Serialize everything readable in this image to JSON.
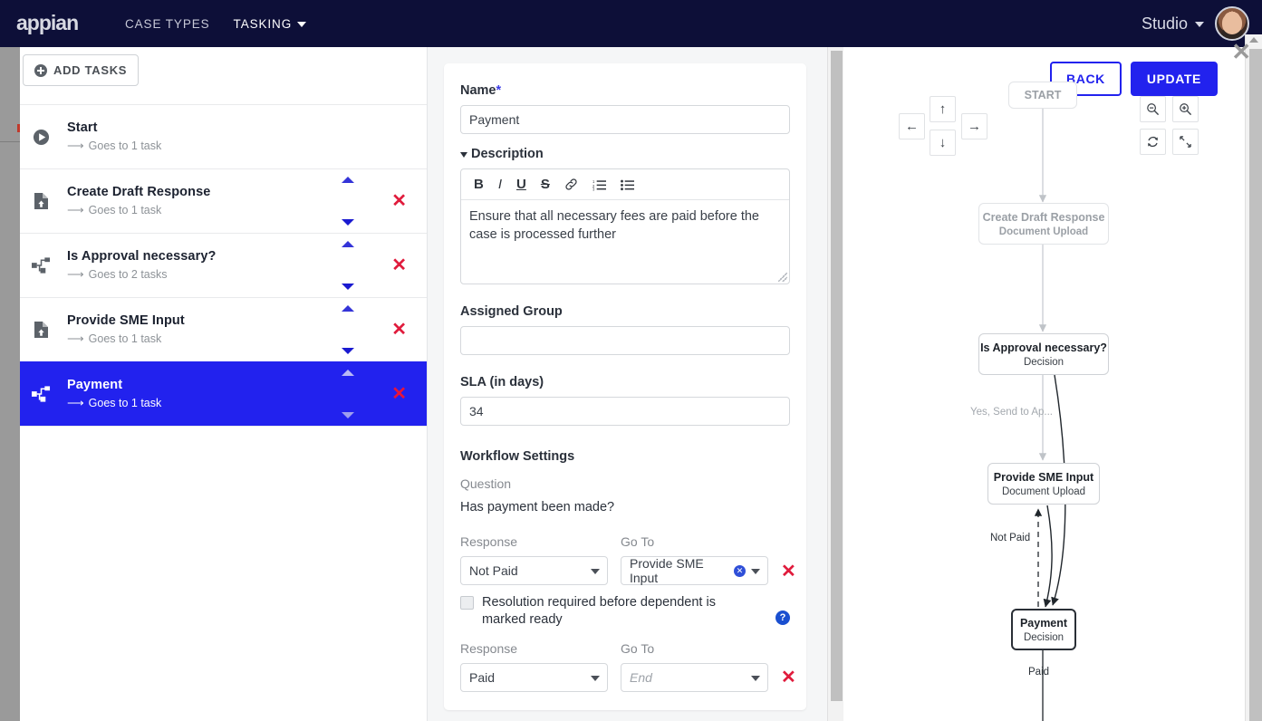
{
  "topnav": {
    "brand": "appian",
    "links": [
      {
        "label": "CASE TYPES",
        "active": false,
        "caret": false
      },
      {
        "label": "TASKING",
        "active": true,
        "caret": true
      }
    ],
    "studio_label": "Studio",
    "avatar_icon": "user-avatar"
  },
  "window": {
    "close_icon": "close-icon"
  },
  "tasks_panel": {
    "add_tasks_label": "Add Tasks",
    "rows": [
      {
        "title": "Start",
        "sub": "Goes to 1 task",
        "icon": "play-circle-icon",
        "selected": false,
        "has_reorder": false,
        "has_delete": false
      },
      {
        "title": "Create Draft Response",
        "sub": "Goes to 1 task",
        "icon": "document-upload-icon",
        "selected": false,
        "has_reorder": true,
        "has_delete": true
      },
      {
        "title": "Is Approval necessary?",
        "sub": "Goes to 2 tasks",
        "icon": "decision-branch-icon",
        "selected": false,
        "has_reorder": true,
        "has_delete": true
      },
      {
        "title": "Provide SME Input",
        "sub": "Goes to 1 task",
        "icon": "document-upload-icon",
        "selected": false,
        "has_reorder": true,
        "has_delete": true
      },
      {
        "title": "Payment",
        "sub": "Goes to 1 task",
        "icon": "decision-branch-icon",
        "selected": true,
        "has_reorder": true,
        "has_delete": true
      }
    ]
  },
  "form": {
    "name_label": "Name",
    "name_required_mark": "*",
    "name_value": "Payment",
    "description_label": "Description",
    "rte_buttons": [
      "bold-icon",
      "italic-icon",
      "underline-icon",
      "strikethrough-icon",
      "link-icon",
      "ordered-list-icon",
      "bullet-list-icon"
    ],
    "description_value": "Ensure that all necessary fees are paid before the case is processed further",
    "assigned_group_label": "Assigned Group",
    "assigned_group_value": "",
    "assigned_group_placeholder": "",
    "sla_label": "SLA (in days)",
    "sla_value": "34",
    "workflow_settings_label": "Workflow Settings",
    "question_label": "Question",
    "question_value": "Has payment been made?",
    "response_col_label": "Response",
    "goto_col_label": "Go To",
    "rows": [
      {
        "response": "Not Paid",
        "goto": "Provide SME Input",
        "goto_is_placeholder": false,
        "goto_has_chip_clear": true,
        "delete_icon": "delete-row-icon"
      },
      {
        "response": "Paid",
        "goto": "End",
        "goto_is_placeholder": true,
        "goto_has_chip_clear": false,
        "delete_icon": "delete-row-icon"
      }
    ],
    "resolution_checkbox_label": "Resolution required before dependent is marked ready",
    "resolution_checkbox_checked": false,
    "help_icon_label": "?"
  },
  "diagram": {
    "back_label": "Back",
    "update_label": "Update",
    "pan_controls": [
      {
        "icon": "arrow-up-icon",
        "glyph": "↑"
      },
      {
        "icon": "arrow-left-icon",
        "glyph": "←"
      },
      {
        "icon": "arrow-right-icon",
        "glyph": "→"
      },
      {
        "icon": "arrow-down-icon",
        "glyph": "↓"
      }
    ],
    "zoom_controls": [
      {
        "icon": "zoom-out-icon"
      },
      {
        "icon": "zoom-in-icon"
      },
      {
        "icon": "refresh-icon"
      },
      {
        "icon": "fit-screen-icon"
      }
    ],
    "nodes": [
      {
        "title": "START",
        "sub": "",
        "style": "faint"
      },
      {
        "title": "Create Draft Response",
        "sub": "Document Upload",
        "style": "faint"
      },
      {
        "title": "Is Approval necessary?",
        "sub": "Decision",
        "style": "normal"
      },
      {
        "title": "Provide SME Input",
        "sub": "Document Upload",
        "style": "normal"
      },
      {
        "title": "Payment",
        "sub": "Decision",
        "style": "selected"
      }
    ],
    "edge_labels": [
      {
        "text": "Yes, Send to Ap...",
        "style": "faint"
      },
      {
        "text": "Not Paid",
        "style": "dark"
      },
      {
        "text": "Paid",
        "style": "dark"
      }
    ]
  }
}
